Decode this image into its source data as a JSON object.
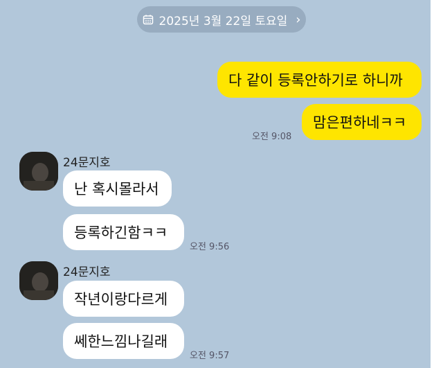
{
  "date_divider": {
    "label": "2025년 3월 22일 토요일",
    "icon": "calendar-icon",
    "chevron": "chevron-right-icon"
  },
  "messages_out": [
    {
      "text": "다 같이 등록안하기로 하니까"
    },
    {
      "text": "맘은편하네ㅋㅋ"
    }
  ],
  "time_out": "오전 9:08",
  "group1": {
    "sender": "24문지호",
    "messages": [
      {
        "text": "난 혹시몰라서"
      },
      {
        "text": "등록하긴함ㅋㅋ"
      }
    ],
    "time": "오전 9:56"
  },
  "group2": {
    "sender": "24문지호",
    "messages": [
      {
        "text": "작년이랑다르게"
      },
      {
        "text": "쎄한느낌나길래"
      }
    ],
    "time": "오전 9:57"
  },
  "colors": {
    "background": "#b2c7da",
    "my_bubble": "#fee500",
    "their_bubble": "#ffffff"
  }
}
